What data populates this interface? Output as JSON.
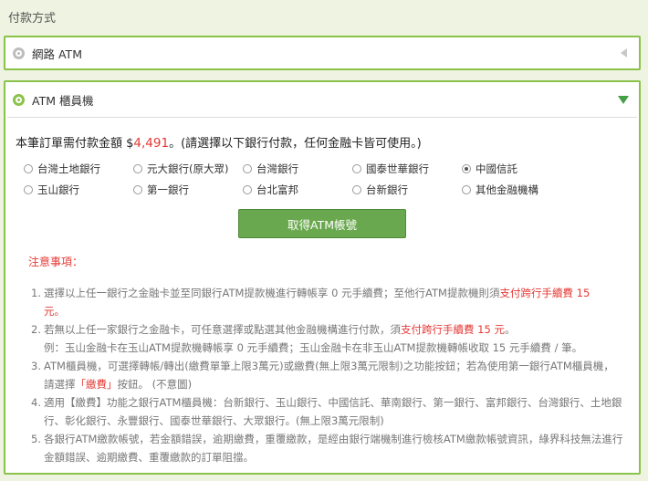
{
  "section_title": "付款方式",
  "options": {
    "online_atm": {
      "label": "網路 ATM",
      "selected": false
    },
    "counter_atm": {
      "label": "ATM 櫃員機",
      "selected": true
    }
  },
  "amount": {
    "prefix": "本筆訂單需付款金額 $",
    "value": "4,491",
    "suffix": "。(請選擇以下銀行付款，任何金融卡皆可使用。)"
  },
  "banks": [
    {
      "label": "台灣土地銀行",
      "selected": false
    },
    {
      "label": "元大銀行(原大眾)",
      "selected": false
    },
    {
      "label": "台灣銀行",
      "selected": false
    },
    {
      "label": "國泰世華銀行",
      "selected": false
    },
    {
      "label": "中國信託",
      "selected": true
    },
    {
      "label": "玉山銀行",
      "selected": false
    },
    {
      "label": "第一銀行",
      "selected": false
    },
    {
      "label": "台北富邦",
      "selected": false
    },
    {
      "label": "台新銀行",
      "selected": false
    },
    {
      "label": "其他金融機構",
      "selected": false
    }
  ],
  "get_button": "取得ATM帳號",
  "notice": {
    "title": "注意事項：",
    "n1a": "選擇以上任一銀行之金融卡並至同銀行ATM提款機進行轉帳享 0 元手續費；至他行ATM提款機則須",
    "n1b": "支付跨行手續費 15",
    "n1c": "元。",
    "n2a": "若無以上任一家銀行之金融卡，可任意選擇或點選其他金融機構進行付款，須",
    "n2b": "支付跨行手續費 15 元",
    "n2c": "。",
    "n2d": "例：玉山金融卡在玉山ATM提款機轉帳享 0 元手續費；玉山金融卡在非玉山ATM提款機轉帳收取 15 元手續費 / 筆。",
    "n3a": "ATM櫃員機，可選擇轉帳/轉出(繳費單筆上限3萬元)或繳費(無上限3萬元限制)之功能按鈕；若為使用第一銀行ATM櫃員機，請選擇",
    "n3b": "「繳費」",
    "n3c": "按鈕。 (不意圖)",
    "n4": "適用【繳費】功能之銀行ATM櫃員機：台新銀行、玉山銀行、中國信託、華南銀行、第一銀行、富邦銀行、台灣銀行、土地銀行、彰化銀行、永豐銀行、國泰世華銀行、大眾銀行。(無上限3萬元限制)",
    "n5": "各銀行ATM繳款帳號，若金額錯誤，逾期繳費，重覆繳款，是經由銀行端機制進行檢核ATM繳款帳號資訊，綠界科技無法進行金額錯誤、逾期繳費、重覆繳款的訂單阻擋。"
  },
  "colors": {
    "accent_green": "#8bc34a",
    "button_green": "#6aa84f",
    "alert_red": "#e53935",
    "page_bg": "#eef3e2"
  }
}
